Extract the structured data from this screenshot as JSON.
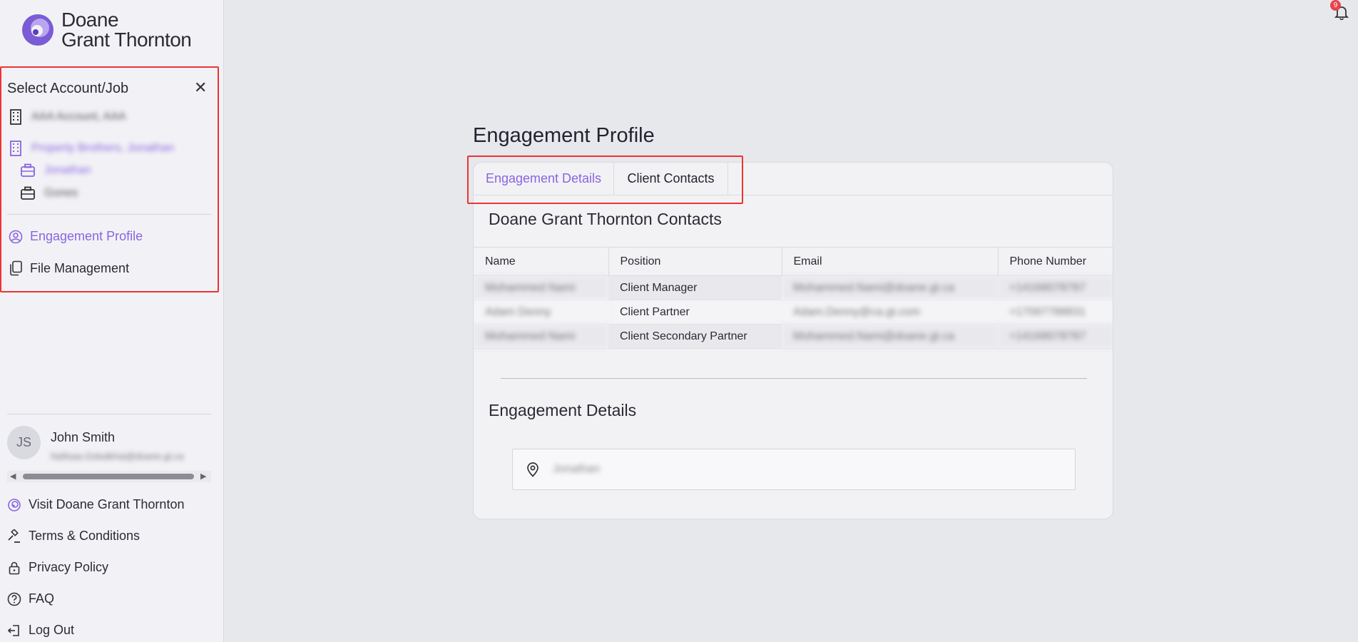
{
  "brand": {
    "line1": "Doane",
    "line2": "Grant Thornton",
    "accent": "#8a64e0",
    "highlight": "#e33333"
  },
  "sidebar": {
    "panel_title": "Select Account/Job",
    "close_icon": "close-icon",
    "accounts": [
      {
        "label": "AAA Account, AAA",
        "icon": "building-icon",
        "active": false
      },
      {
        "label": "Property Brothers, Jonathan",
        "icon": "building-icon",
        "active": true
      }
    ],
    "jobs": [
      {
        "label": "Jonathan",
        "icon": "briefcase-icon",
        "active": true
      },
      {
        "label": "Gones",
        "icon": "briefcase-icon",
        "active": false
      }
    ],
    "nav": [
      {
        "label": "Engagement Profile",
        "icon": "user-circle-icon",
        "active": true
      },
      {
        "label": "File Management",
        "icon": "files-icon",
        "active": false
      }
    ],
    "user": {
      "initials": "JS",
      "name": "John Smith",
      "email": "Nafisaa.Gokalkhai@doane.gt.ca"
    },
    "footer_links": [
      {
        "label": "Visit Doane Grant Thornton",
        "icon": "brand-icon"
      },
      {
        "label": "Terms & Conditions",
        "icon": "gavel-icon"
      },
      {
        "label": "Privacy Policy",
        "icon": "lock-icon"
      },
      {
        "label": "FAQ",
        "icon": "question-icon"
      },
      {
        "label": "Log Out",
        "icon": "logout-icon"
      }
    ]
  },
  "notifications": {
    "count": "9",
    "icon": "bell-icon"
  },
  "main": {
    "title": "Engagement Profile",
    "tabs": [
      {
        "label": "Engagement Details",
        "active": true
      },
      {
        "label": "Client Contacts",
        "active": false
      }
    ],
    "contacts_title": "Doane Grant Thornton Contacts",
    "table": {
      "columns": [
        "Name",
        "Position",
        "Email",
        "Phone Number"
      ],
      "rows": [
        [
          "Mohammed Nami",
          "Client Manager",
          "Mohammed.Nami@doane.gt.ca",
          "+14168078787"
        ],
        [
          "Adam Denny",
          "Client Partner",
          "Adam.Denny@ca.gt.com",
          "+17097788831"
        ],
        [
          "Mohammed Nami",
          "Client Secondary Partner",
          "Mohammed.Nami@doane.gt.ca",
          "+14168078787"
        ]
      ]
    },
    "details_title": "Engagement Details",
    "location": {
      "icon": "map-pin-icon",
      "value": "Jonathan"
    }
  }
}
